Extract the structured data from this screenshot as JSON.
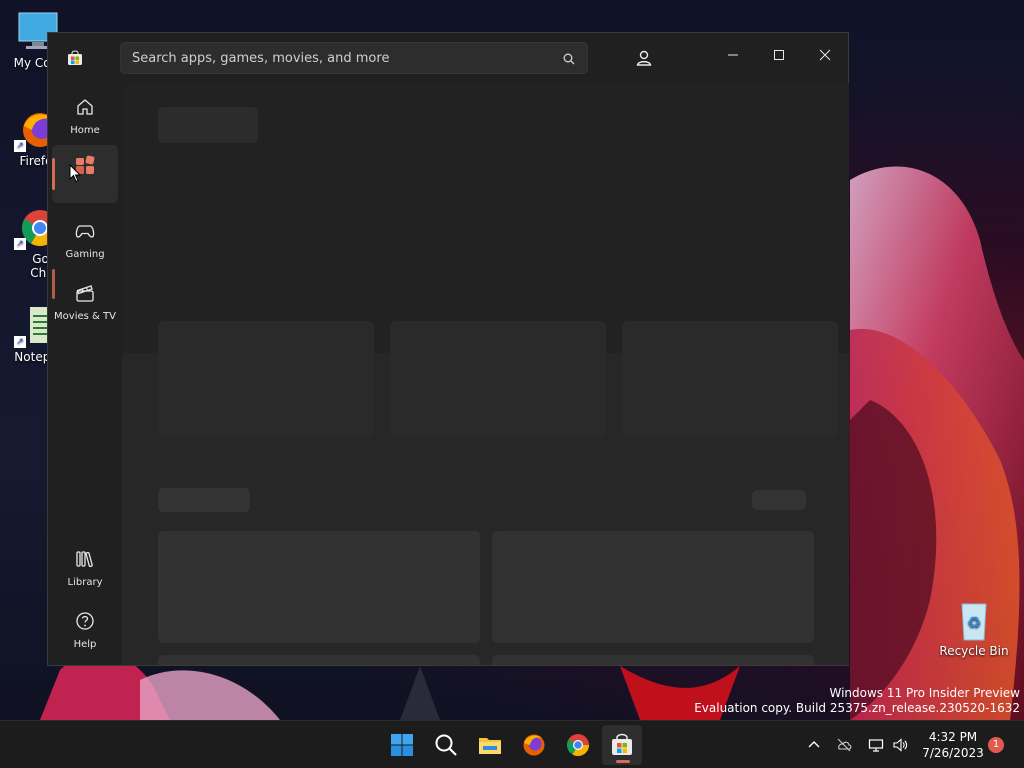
{
  "desktop": {
    "icons": [
      {
        "label": "My Com",
        "icon": "computer-icon"
      },
      {
        "label": "Firefo",
        "icon": "firefox-icon"
      },
      {
        "label": "Goog Chron",
        "icon": "chrome-icon"
      },
      {
        "label": "Notepa",
        "icon": "notepad-icon"
      }
    ],
    "recycle_bin": {
      "label": "Recycle Bin",
      "icon": "recycle-bin-icon"
    },
    "watermark": {
      "line1": "Windows 11 Pro Insider Preview",
      "line2": "Evaluation copy. Build 25375.zn_release.230520-1632"
    }
  },
  "store": {
    "search": {
      "placeholder": "Search apps, games, movies, and more"
    },
    "nav": [
      {
        "label": "Home",
        "icon": "home-icon"
      },
      {
        "label": "",
        "icon": "apps-icon",
        "active": true
      },
      {
        "label": "Gaming",
        "icon": "gamepad-icon"
      },
      {
        "label": "Movies & TV",
        "icon": "clapperboard-icon"
      }
    ],
    "nav_bottom": [
      {
        "label": "Library",
        "icon": "library-icon"
      },
      {
        "label": "Help",
        "icon": "help-icon"
      }
    ]
  },
  "taskbar": {
    "apps": [
      "windows-start-icon",
      "search-icon",
      "file-explorer-icon",
      "firefox-icon",
      "chrome-icon",
      "microsoft-store-icon"
    ],
    "clock": {
      "time": "4:32 PM",
      "date": "7/26/2023"
    },
    "notification_count": "1"
  },
  "colors": {
    "accent": "#d46c55",
    "window_bg": "#202020",
    "content_bg": "#272727"
  }
}
